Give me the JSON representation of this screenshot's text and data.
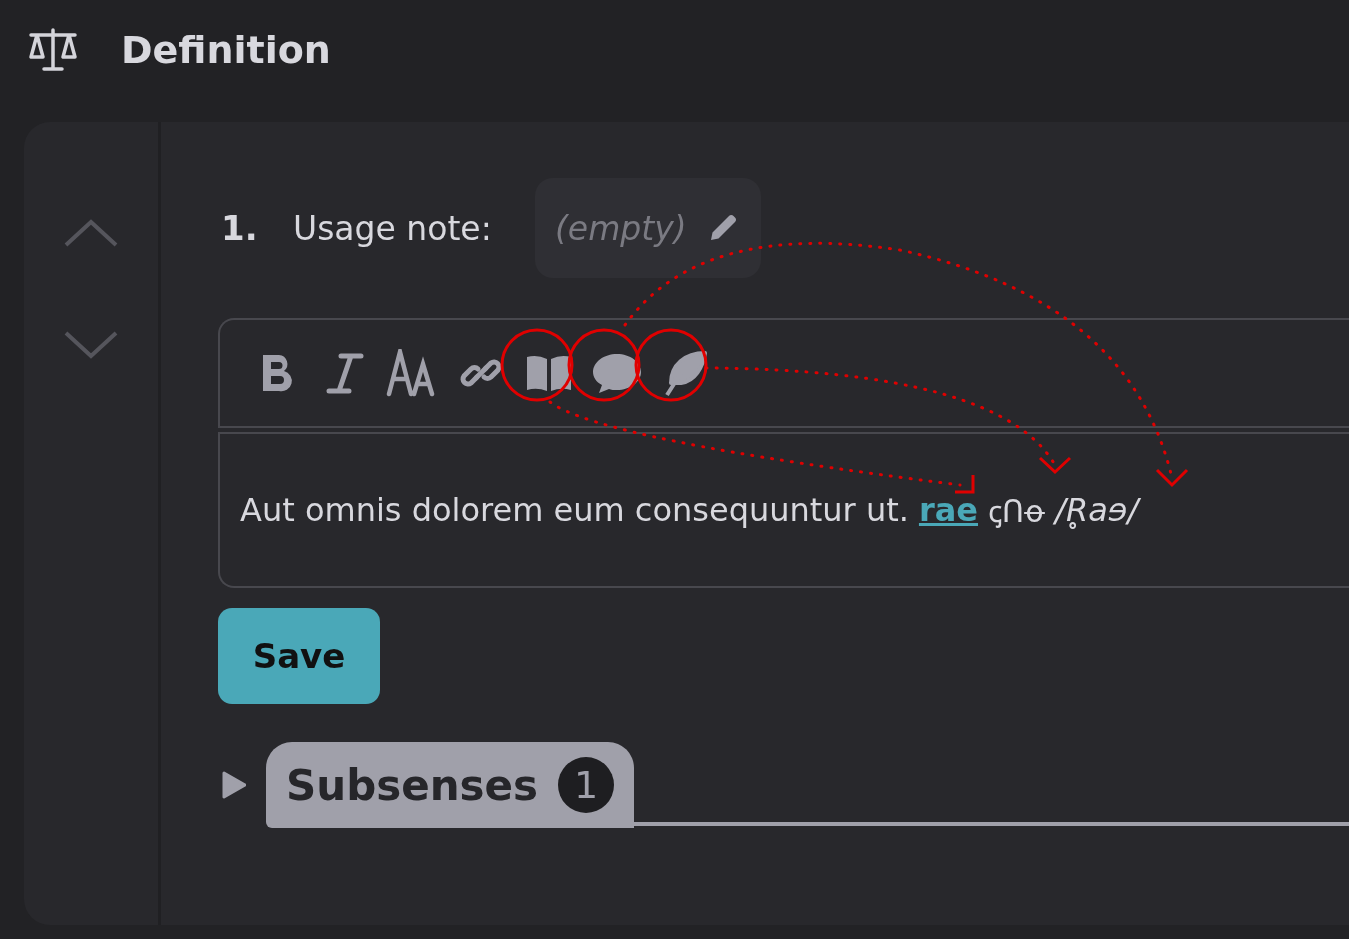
{
  "header": {
    "title": "Definition"
  },
  "sense": {
    "number": "1.",
    "usage_label": "Usage note:",
    "usage_value": "(empty)",
    "editor": {
      "text": "Aut omnis dolorem eum consequuntur ut.",
      "link": "rae",
      "script": "ꞔᑎꝋ",
      "ipa": "/R̥aɘ/"
    },
    "save": "Save",
    "subsenses": {
      "label": "Subsenses",
      "count": "1",
      "expanded": false
    }
  }
}
